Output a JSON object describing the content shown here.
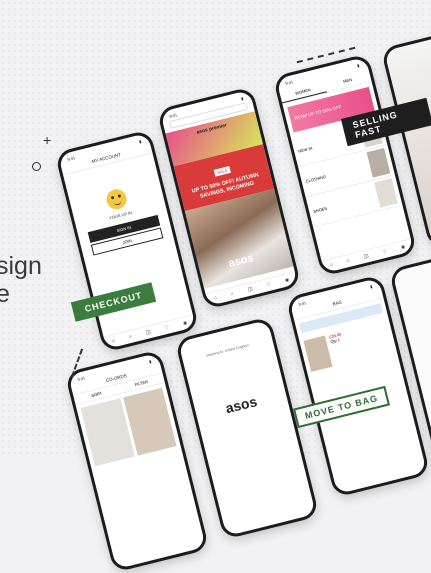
{
  "hero": {
    "line1": "sign",
    "line2": "e"
  },
  "phone_account": {
    "time": "9:41",
    "header": "MY ACCOUNT",
    "greeting": "YOUR UP IN",
    "btn_signin": "SIGN IN",
    "btn_join": "JOIN"
  },
  "phone_home": {
    "time": "9:41",
    "logo": "asos premier",
    "banner": "UP TO 50% OFF! AUTUMN SAVINGS, INCOMING",
    "sale": "SALE",
    "brand": "asos"
  },
  "phone_category": {
    "time": "9:41",
    "tabs": [
      "WOMEN",
      "MEN"
    ],
    "promo": "WOW! UP TO 50% OFF",
    "items": [
      "NEW IN",
      "CLOTHING",
      "SHOES"
    ]
  },
  "phone_splash": {
    "logo": "asos",
    "ship": "Shipping to: United Kingdom"
  },
  "phone_bag": {
    "time": "9:41",
    "header": "BAG",
    "price": "£35.00",
    "qty": "Qty 1"
  },
  "phone_results": {
    "time": "9:41",
    "header": "CO-ORDS",
    "filter": "FILTER",
    "sort": "SORT"
  },
  "tags": {
    "checkout": "CHECKOUT",
    "selling_fast": "SELLING FAST",
    "move_to_bag": "MOVE TO BAG"
  },
  "colors": {
    "checkout": "#3b7d3e",
    "gradient_a": "#e8508a",
    "gradient_b": "#d8e65a",
    "sale_red": "#d93a3a",
    "selling_fast": "#1e1e1e"
  }
}
